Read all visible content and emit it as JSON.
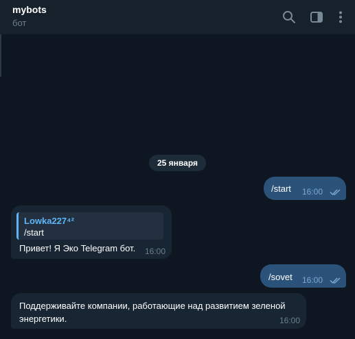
{
  "header": {
    "title": "mybots",
    "subtitle": "бот",
    "icons": [
      "search-icon",
      "sidebar-toggle-icon",
      "more-vertical-icon"
    ]
  },
  "chat": {
    "date_separator": "25 января",
    "messages": [
      {
        "direction": "outgoing",
        "text": "/start",
        "time": "16:00",
        "status": "read"
      },
      {
        "direction": "incoming",
        "reply_to": {
          "author": "Lowka227⁴²",
          "text": "/start"
        },
        "text": "Привет! Я Эко Telegram бот.",
        "time": "16:00"
      },
      {
        "direction": "outgoing",
        "text": "/sovet",
        "time": "16:00",
        "status": "read"
      },
      {
        "direction": "incoming",
        "text": "Поддерживайте компании, работающие над развитием зеленой энергетики.",
        "time": "16:00"
      }
    ]
  },
  "colors": {
    "background": "#0e1621",
    "header": "#17212b",
    "outgoing_bubble": "#2b5278",
    "incoming_bubble": "#182533",
    "accent": "#5eb5f7",
    "muted_text": "#6d7f8f"
  }
}
